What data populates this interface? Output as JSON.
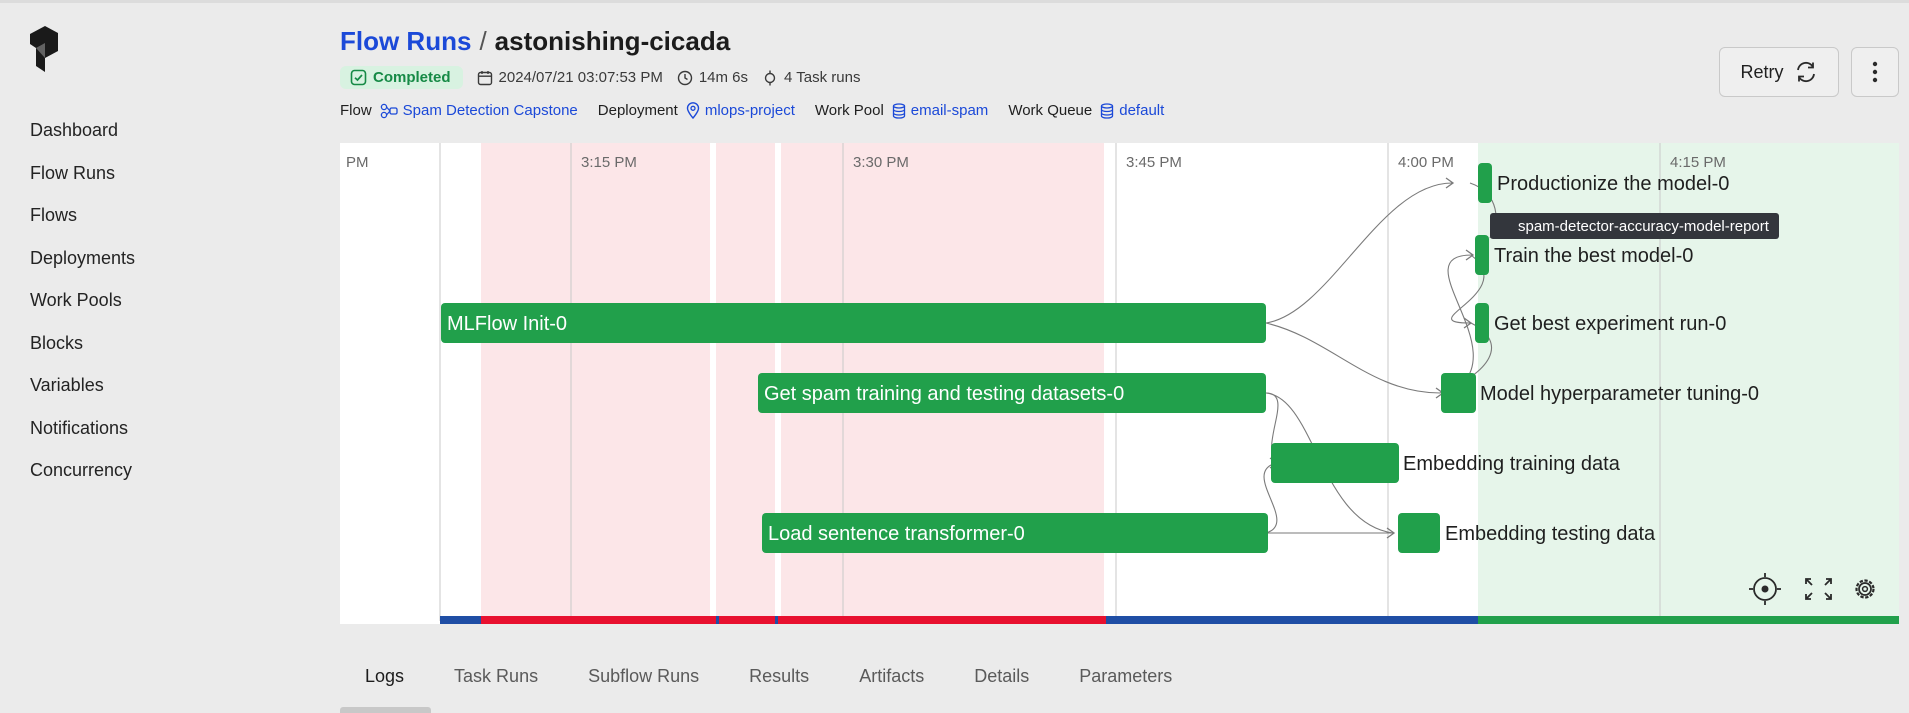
{
  "breadcrumb": {
    "parent": "Flow Runs",
    "separator": "/",
    "current": "astonishing-cicada"
  },
  "status": {
    "label": "Completed",
    "color": "#168a46"
  },
  "meta": {
    "start_time": "2024/07/21 03:07:53 PM",
    "duration": "14m 6s",
    "task_runs": "4 Task runs"
  },
  "info": {
    "flow_label": "Flow",
    "flow_value": "Spam Detection Capstone",
    "deployment_label": "Deployment",
    "deployment_value": "mlops-project",
    "work_pool_label": "Work Pool",
    "work_pool_value": "email-spam",
    "work_queue_label": "Work Queue",
    "work_queue_value": "default"
  },
  "actions": {
    "retry_label": "Retry"
  },
  "sidebar": {
    "items": [
      {
        "label": "Dashboard"
      },
      {
        "label": "Flow Runs"
      },
      {
        "label": "Flows"
      },
      {
        "label": "Deployments"
      },
      {
        "label": "Work Pools"
      },
      {
        "label": "Blocks"
      },
      {
        "label": "Variables"
      },
      {
        "label": "Notifications"
      },
      {
        "label": "Concurrency"
      }
    ]
  },
  "timeline": {
    "time_labels": [
      "PM",
      "3:15 PM",
      "3:30 PM",
      "3:45 PM",
      "4:00 PM",
      "4:15 PM"
    ],
    "tasks": [
      {
        "label": "MLFlow Init-0"
      },
      {
        "label": "Get spam training and testing datasets-0"
      },
      {
        "label": "Load sentence transformer-0"
      },
      {
        "label": "Embedding training data"
      },
      {
        "label": "Embedding testing data"
      },
      {
        "label": "Productionize the model-0"
      },
      {
        "label": "Train the best model-0"
      },
      {
        "label": "Get best experiment run-0"
      },
      {
        "label": "Model hyperparameter tuning-0"
      }
    ],
    "artifact_label": "spam-detector-accuracy-model-report",
    "colors": {
      "task": "#21a04b",
      "failed_band": "#fce6e8",
      "completed_band": "#e6f5ea",
      "failed_bar": "#e8102f",
      "running_bar": "#1f4ea5",
      "completed_bar": "#21a04b"
    }
  },
  "tabs": [
    {
      "label": "Logs"
    },
    {
      "label": "Task Runs"
    },
    {
      "label": "Subflow Runs"
    },
    {
      "label": "Results"
    },
    {
      "label": "Artifacts"
    },
    {
      "label": "Details"
    },
    {
      "label": "Parameters"
    }
  ]
}
